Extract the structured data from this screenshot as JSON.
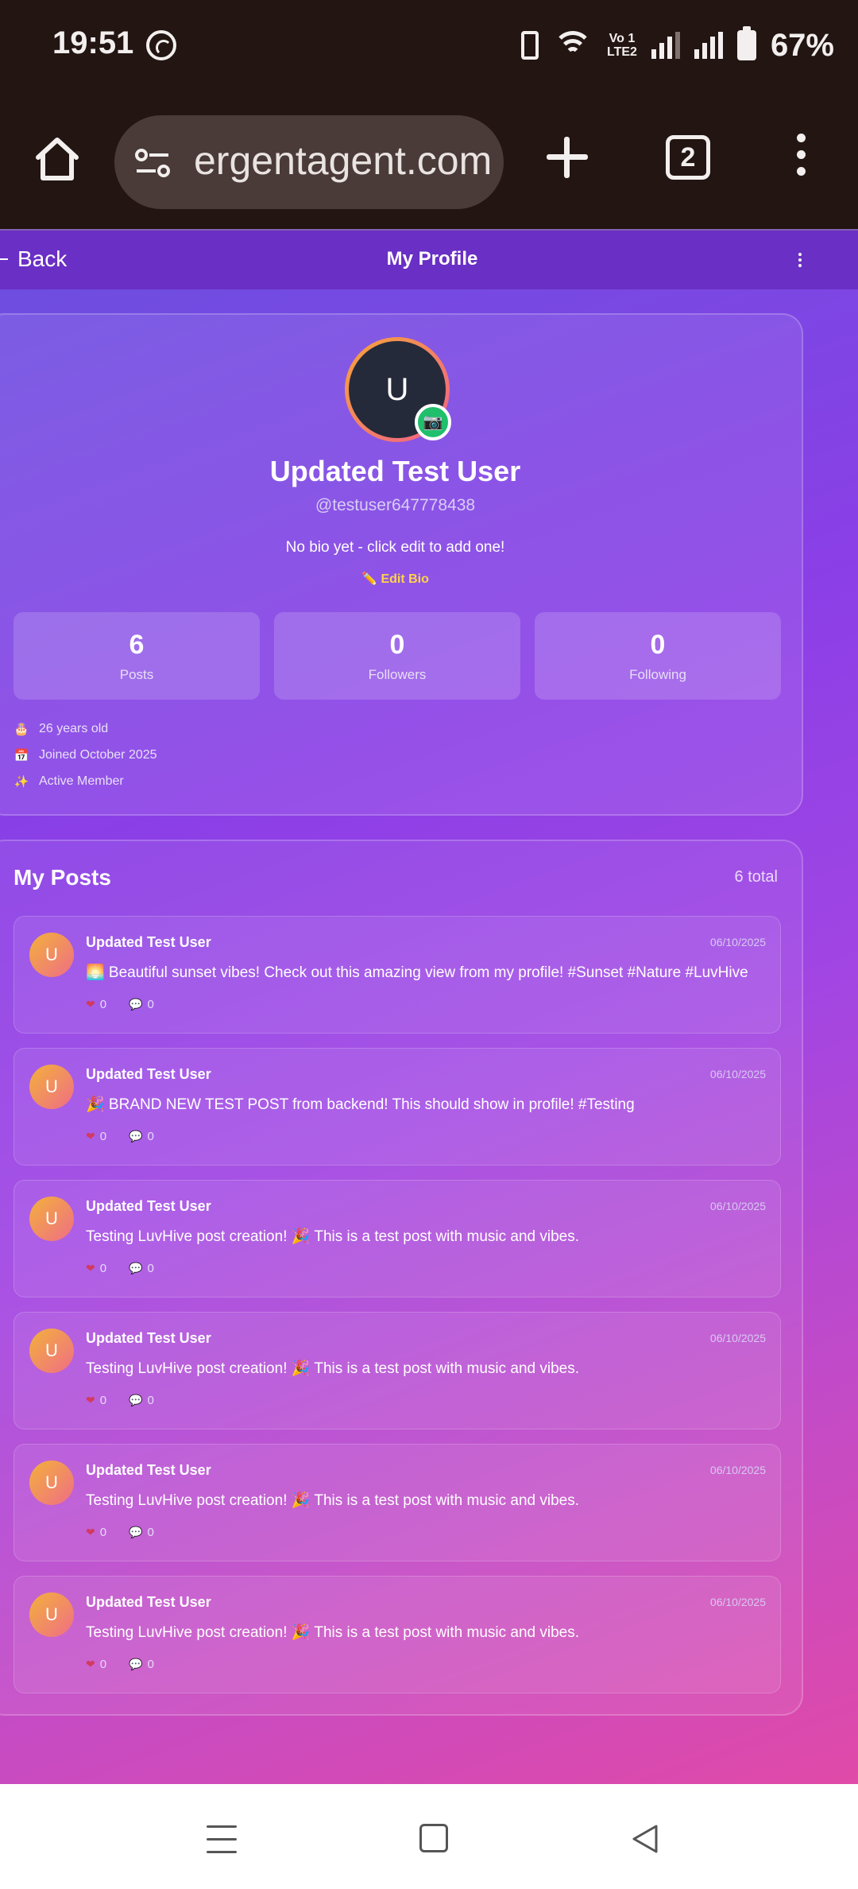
{
  "status_bar": {
    "time": "19:51",
    "lte_label_top": "Vo 1",
    "lte_label_bottom": "LTE2",
    "battery_percent": "67%",
    "icons": [
      "whatsapp-icon",
      "vibrate-icon",
      "wifi-icon",
      "signal-icon",
      "battery-icon"
    ]
  },
  "browser": {
    "url": "ergentagent.com",
    "tab_count": "2",
    "icons": [
      "home-icon",
      "site-settings-icon",
      "new-tab-icon",
      "tabs-icon",
      "more-icon"
    ]
  },
  "header": {
    "back_label": "Back",
    "title": "My Profile"
  },
  "profile": {
    "avatar_initial": "U",
    "camera_badge": "📷",
    "display_name": "Updated Test User",
    "username": "@testuser647778438",
    "bio": "No bio yet - click edit to add one!",
    "edit_bio_label": "✏️ Edit Bio",
    "stats": [
      {
        "value": "6",
        "label": "Posts"
      },
      {
        "value": "0",
        "label": "Followers"
      },
      {
        "value": "0",
        "label": "Following"
      }
    ],
    "meta": [
      {
        "icon": "🎂",
        "text": "26 years old"
      },
      {
        "icon": "📅",
        "text": "Joined October 2025"
      },
      {
        "icon": "✨",
        "text": "Active Member"
      }
    ]
  },
  "posts_section": {
    "title": "My Posts",
    "count_label": "6 total",
    "posts": [
      {
        "initial": "U",
        "author": "Updated Test User",
        "date": "06/10/2025",
        "text": "🌅 Beautiful sunset vibes! Check out this amazing view from my profile! #Sunset #Nature #LuvHive",
        "likes": "0",
        "comments": "0"
      },
      {
        "initial": "U",
        "author": "Updated Test User",
        "date": "06/10/2025",
        "text": "🎉 BRAND NEW TEST POST from backend! This should show in profile! #Testing",
        "likes": "0",
        "comments": "0"
      },
      {
        "initial": "U",
        "author": "Updated Test User",
        "date": "06/10/2025",
        "text": "Testing LuvHive post creation! 🎉 This is a test post with music and vibes.",
        "likes": "0",
        "comments": "0"
      },
      {
        "initial": "U",
        "author": "Updated Test User",
        "date": "06/10/2025",
        "text": "Testing LuvHive post creation! 🎉 This is a test post with music and vibes.",
        "likes": "0",
        "comments": "0"
      },
      {
        "initial": "U",
        "author": "Updated Test User",
        "date": "06/10/2025",
        "text": "Testing LuvHive post creation! 🎉 This is a test post with music and vibes.",
        "likes": "0",
        "comments": "0"
      },
      {
        "initial": "U",
        "author": "Updated Test User",
        "date": "06/10/2025",
        "text": "Testing LuvHive post creation! 🎉 This is a test post with music and vibes.",
        "likes": "0",
        "comments": "0"
      }
    ]
  },
  "colors": {
    "accent_gradient_start": "#6b4fe0",
    "accent_gradient_end": "#e04aa8",
    "edit_bio": "#ffd34a",
    "header": "#6a2fc4"
  }
}
